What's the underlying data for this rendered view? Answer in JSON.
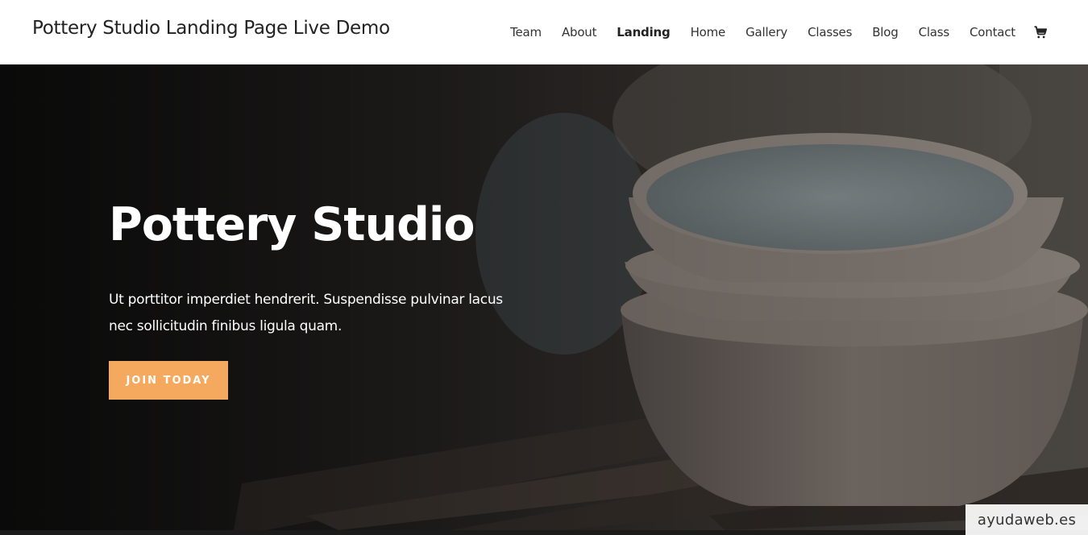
{
  "header": {
    "site_title": "Pottery Studio Landing Page Live Demo",
    "nav": [
      {
        "label": "Team",
        "active": false
      },
      {
        "label": "About",
        "active": false
      },
      {
        "label": "Landing",
        "active": true
      },
      {
        "label": "Home",
        "active": false
      },
      {
        "label": "Gallery",
        "active": false
      },
      {
        "label": "Classes",
        "active": false
      },
      {
        "label": "Blog",
        "active": false
      },
      {
        "label": "Class",
        "active": false
      },
      {
        "label": "Contact",
        "active": false
      }
    ],
    "cart_icon": "shopping-cart-icon"
  },
  "hero": {
    "title": "Pottery Studio",
    "text": "Ut porttitor imperdiet hendrerit. Suspendisse pulvinar lacus nec sollicitudin finibus ligula quam.",
    "button_label": "JOIN TODAY"
  },
  "watermark": "ayudaweb.es",
  "colors": {
    "accent": "#f4a95f",
    "header_bg": "#ffffff",
    "hero_overlay": "#1e1c1b"
  }
}
